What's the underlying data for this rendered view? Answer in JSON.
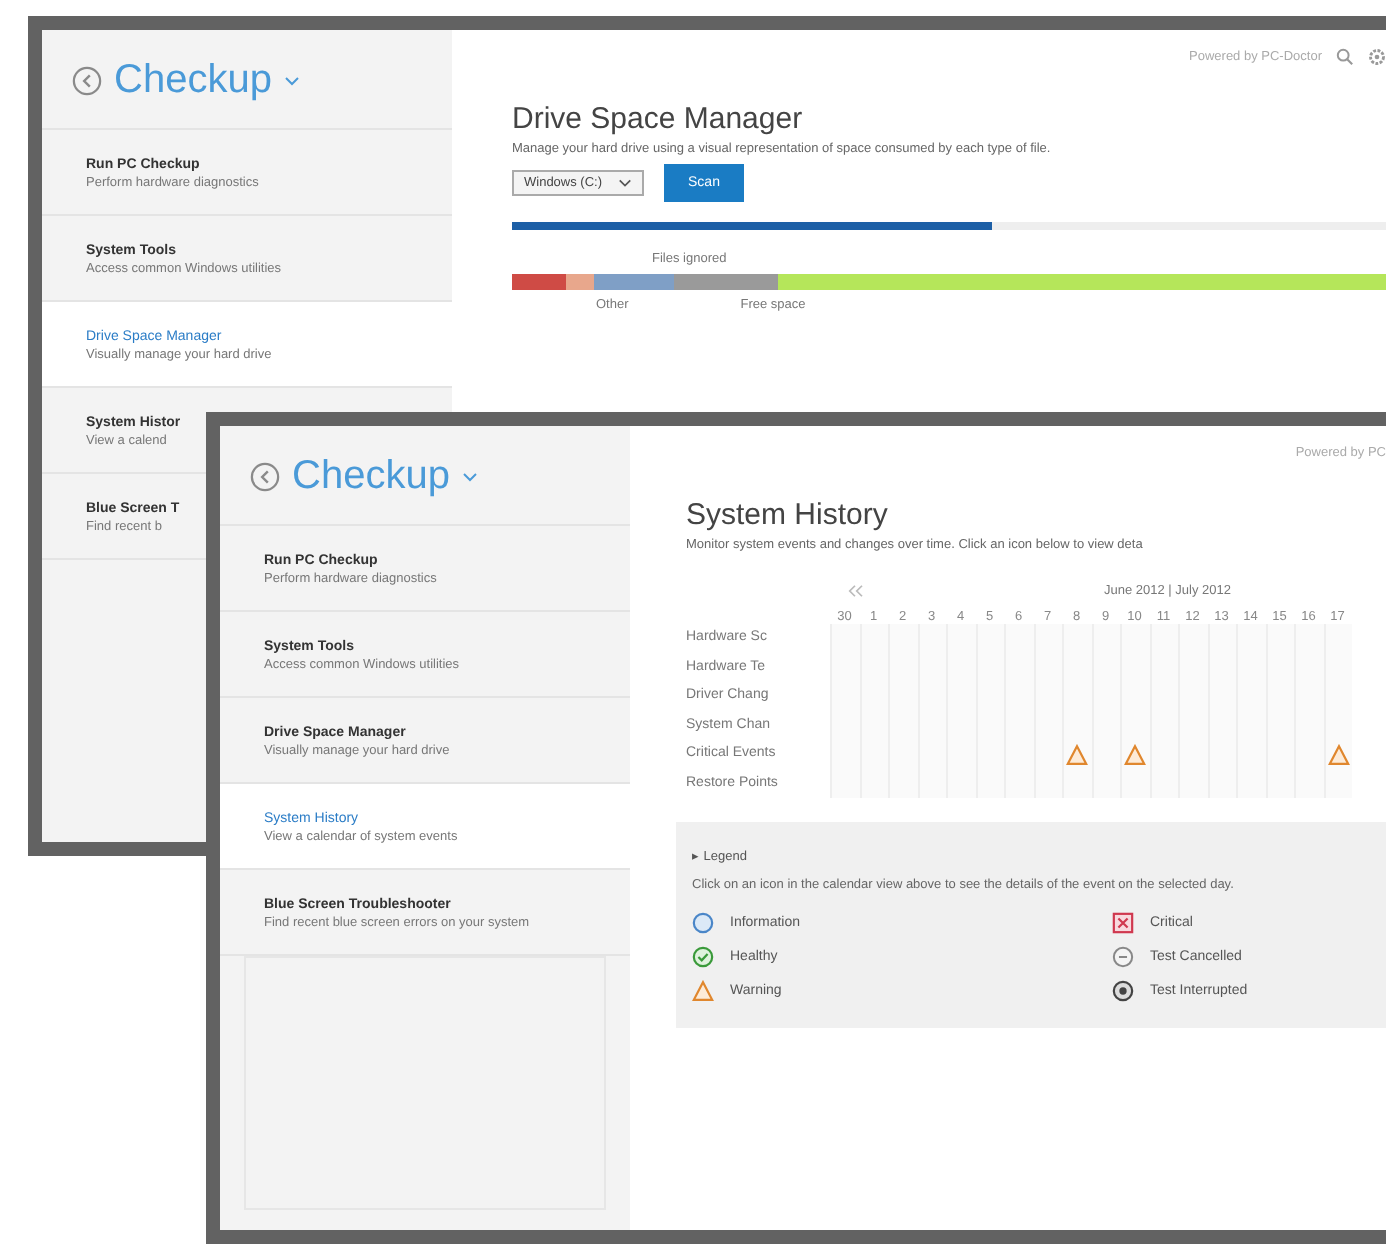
{
  "back_window": {
    "app_title": "Checkup",
    "header_text": "Powered by PC-Doctor",
    "nav": [
      {
        "title": "Run PC Checkup",
        "description": "Perform hardware diagnostics",
        "selected": false
      },
      {
        "title": "System Tools",
        "description": "Access common Windows utilities",
        "selected": false
      },
      {
        "title": "Drive Space Manager",
        "description": "Visually manage your hard drive",
        "selected": true
      },
      {
        "title": "System Histor",
        "description": "View a calend",
        "selected": false
      },
      {
        "title": "Blue Screen T",
        "description": "Find recent b",
        "selected": false
      }
    ],
    "page_title": "Drive Space Manager",
    "description": "Manage your hard drive using a visual representation of space consumed by each type of file.",
    "drive_select": "Windows (C:)",
    "scan_button": "Scan",
    "progress": {
      "level": 0.55
    },
    "usage_label": "Files ignored",
    "segment_labels": [
      "Other",
      "Free space"
    ]
  },
  "front_window": {
    "app_title": "Checkup",
    "header_text": "Powered by PC",
    "nav": [
      {
        "title": "Run PC Checkup",
        "description": "Perform hardware diagnostics",
        "selected": false
      },
      {
        "title": "System Tools",
        "description": "Access common Windows utilities",
        "selected": false
      },
      {
        "title": "Drive Space Manager",
        "description": "Visually manage your hard drive",
        "selected": false
      },
      {
        "title": "System History",
        "description": "View a calendar of system events",
        "selected": true
      },
      {
        "title": "Blue Screen Troubleshooter",
        "description": "Find recent blue screen errors on your system",
        "selected": false
      }
    ],
    "page_title": "System History",
    "description": "Monitor system events and changes over time. Click an icon below to view deta",
    "calendar": {
      "month_label": "June 2012 | July 2012",
      "days": [
        "30",
        "1",
        "2",
        "3",
        "4",
        "5",
        "6",
        "7",
        "8",
        "9",
        "10",
        "11",
        "12",
        "13",
        "14",
        "15",
        "16",
        "17"
      ],
      "rows": [
        {
          "label": "Hardware Sc"
        },
        {
          "label": "Hardware Te"
        },
        {
          "label": "Driver Chang"
        },
        {
          "label": "System Chan"
        },
        {
          "label": "Critical Events",
          "cells": [
            {
              "kind": "empty"
            },
            {
              "kind": "empty"
            },
            {
              "kind": "empty"
            },
            {
              "kind": "empty"
            },
            {
              "kind": "empty"
            },
            {
              "kind": "empty"
            },
            {
              "kind": "empty"
            },
            {
              "kind": "empty"
            },
            {
              "kind": "warning"
            },
            {
              "kind": "empty"
            },
            {
              "kind": "warning"
            },
            {
              "kind": "empty"
            },
            {
              "kind": "empty"
            },
            {
              "kind": "empty"
            },
            {
              "kind": "empty"
            },
            {
              "kind": "empty"
            },
            {
              "kind": "empty"
            },
            {
              "kind": "warning"
            }
          ]
        },
        {
          "label": "Restore Points"
        }
      ]
    },
    "legend": {
      "toggle": "▸ Legend",
      "text": "Click on an icon in the calendar view above to see the details of the event on the selected day.",
      "items": [
        {
          "kind": "information",
          "label": "Information"
        },
        {
          "kind": "healthy",
          "label": "Healthy"
        },
        {
          "kind": "warning",
          "label": "Warning"
        },
        {
          "kind": "critical",
          "label": "Critical"
        },
        {
          "kind": "cancelled",
          "label": "Test Cancelled"
        },
        {
          "kind": "interrupted",
          "label": "Test Interrupted"
        }
      ]
    }
  }
}
